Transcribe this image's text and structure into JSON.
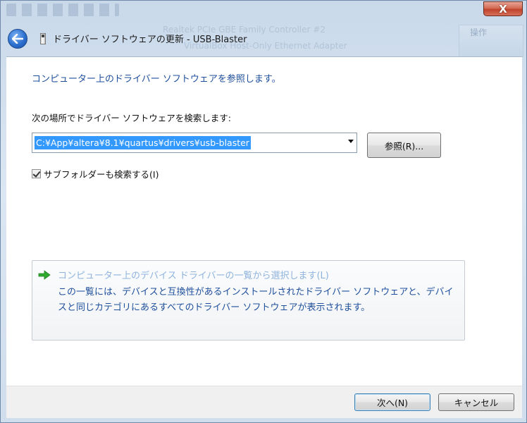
{
  "window": {
    "title": "ドライバー ソフトウェアの更新 - USB-Blaster",
    "close_label": "X"
  },
  "background": {
    "ghost_line1": "Realtek PCIe GBE Family Controller #2",
    "ghost_line2": "VirtualBox Host-Only Ethernet Adapter",
    "ghost_right": "操作"
  },
  "main": {
    "heading": "コンピューター上のドライバー ソフトウェアを参照します。",
    "search_label": "次の場所でドライバー ソフトウェアを検索します:",
    "path_value": "C:¥App¥altera¥8.1¥quartus¥drivers¥usb-blaster",
    "browse_label": "参照(R)...",
    "include_subfolders_label": "サブフォルダーも検索する(I)",
    "include_subfolders_checked": true,
    "option": {
      "title": "コンピューター上のデバイス ドライバーの一覧から選択します(L)",
      "description": "この一覧には、デバイスと互換性があるインストールされたドライバー ソフトウェアと、デバイスと同じカテゴリにあるすべてのドライバー ソフトウェアが表示されます。"
    }
  },
  "footer": {
    "next_label": "次へ(N)",
    "cancel_label": "キャンセル"
  },
  "colors": {
    "heading": "#1e4f9c",
    "selection": "#3399ff",
    "option_title": "#8fb3dd",
    "arrow_green": "#2eaa2e"
  },
  "icons": [
    "back-arrow-icon",
    "usb-device-icon",
    "green-arrow-icon",
    "close-icon"
  ]
}
